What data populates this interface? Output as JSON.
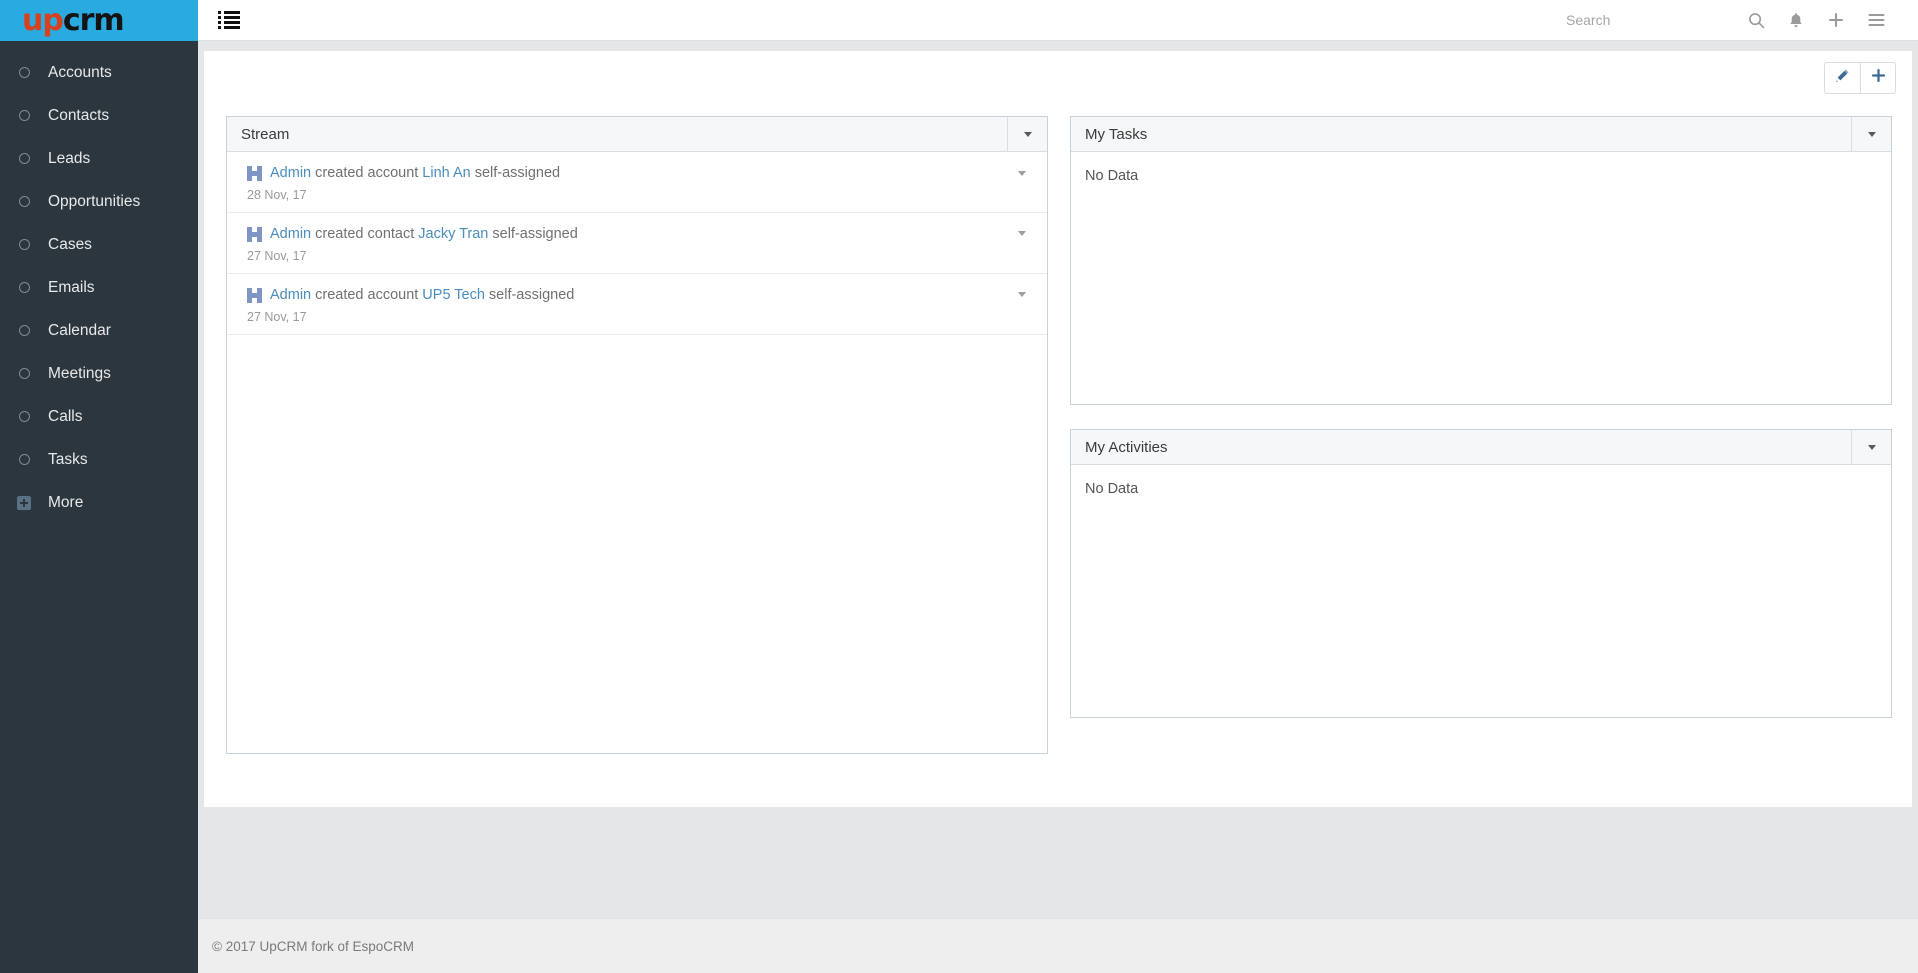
{
  "brand": {
    "logo_first": "up",
    "logo_second": "crm",
    "logo_color_first": "#d9411e",
    "logo_color_second": "#141414",
    "logo_bg": "#29abe2"
  },
  "sidebar": {
    "bg_color": "#2b363e",
    "items": [
      {
        "label": "Accounts",
        "icon": "circle-icon"
      },
      {
        "label": "Contacts",
        "icon": "circle-icon"
      },
      {
        "label": "Leads",
        "icon": "circle-icon"
      },
      {
        "label": "Opportunities",
        "icon": "circle-icon"
      },
      {
        "label": "Cases",
        "icon": "circle-icon"
      },
      {
        "label": "Emails",
        "icon": "circle-icon"
      },
      {
        "label": "Calendar",
        "icon": "circle-icon"
      },
      {
        "label": "Meetings",
        "icon": "circle-icon"
      },
      {
        "label": "Calls",
        "icon": "circle-icon"
      },
      {
        "label": "Tasks",
        "icon": "circle-icon"
      },
      {
        "label": "More",
        "icon": "plus-square-icon"
      }
    ]
  },
  "topbar": {
    "menu_toggle_icon": "list-menu-icon",
    "search": {
      "placeholder": "Search",
      "value": ""
    },
    "actions": [
      {
        "name": "search-icon"
      },
      {
        "name": "bell-icon"
      },
      {
        "name": "plus-icon"
      },
      {
        "name": "hamburger-icon"
      }
    ]
  },
  "toolbar": {
    "edit_icon": "pencil-icon",
    "add_icon": "plus-icon"
  },
  "panels": {
    "stream": {
      "title": "Stream",
      "caret_icon": "chevron-down-icon",
      "items": [
        {
          "actor": "Admin",
          "action": "created account",
          "target": "Linh An",
          "suffix": "self-assigned",
          "date": "28 Nov, 17"
        },
        {
          "actor": "Admin",
          "action": "created contact",
          "target": "Jacky Tran",
          "suffix": "self-assigned",
          "date": "27 Nov, 17"
        },
        {
          "actor": "Admin",
          "action": "created account",
          "target": "UP5 Tech",
          "suffix": "self-assigned",
          "date": "27 Nov, 17"
        }
      ]
    },
    "my_tasks": {
      "title": "My Tasks",
      "empty_text": "No Data",
      "caret_icon": "chevron-down-icon"
    },
    "my_activities": {
      "title": "My Activities",
      "empty_text": "No Data",
      "caret_icon": "chevron-down-icon"
    }
  },
  "footer": {
    "text": "© 2017 UpCRM fork of EspoCRM"
  }
}
